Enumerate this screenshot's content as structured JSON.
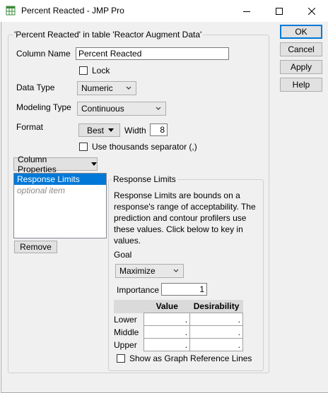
{
  "window": {
    "title": "Percent Reacted - JMP Pro",
    "icon": "jmp-data-table-icon",
    "controls": [
      "minimize-icon",
      "maximize-icon",
      "close-icon"
    ]
  },
  "buttons": {
    "ok": "OK",
    "cancel": "Cancel",
    "apply": "Apply",
    "help": "Help"
  },
  "column_group": {
    "title": "'Percent Reacted' in table 'Reactor Augment Data'",
    "column_name_label": "Column Name",
    "column_name_value": "Percent Reacted",
    "lock_label": "Lock",
    "data_type_label": "Data Type",
    "data_type_value": "Numeric",
    "modeling_type_label": "Modeling Type",
    "modeling_type_value": "Continuous",
    "format_label": "Format",
    "format_value": "Best",
    "width_label": "Width",
    "width_value": "8",
    "thousands_label": "Use thousands separator (,)"
  },
  "column_properties": {
    "menu_label": "Column Properties",
    "list_items": [
      "Response Limits",
      "optional item"
    ],
    "remove_label": "Remove"
  },
  "response_limits": {
    "title": "Response Limits",
    "description": "Response Limits are bounds on a response's range of acceptability. The prediction and contour profilers use these values. Click below to key in values.",
    "goal_label": "Goal",
    "goal_value": "Maximize",
    "importance_label": "Importance",
    "importance_value": "1",
    "table_headers": [
      "",
      "Value",
      "Desirability"
    ],
    "rows": [
      {
        "label": "Lower",
        "value": ".",
        "desirability": "."
      },
      {
        "label": "Middle",
        "value": ".",
        "desirability": "."
      },
      {
        "label": "Upper",
        "value": ".",
        "desirability": "."
      }
    ],
    "reference_lines_label": "Show as Graph Reference Lines"
  },
  "colors": {
    "selection": "#0078d7",
    "dialog_bg": "#f0f0f0"
  }
}
